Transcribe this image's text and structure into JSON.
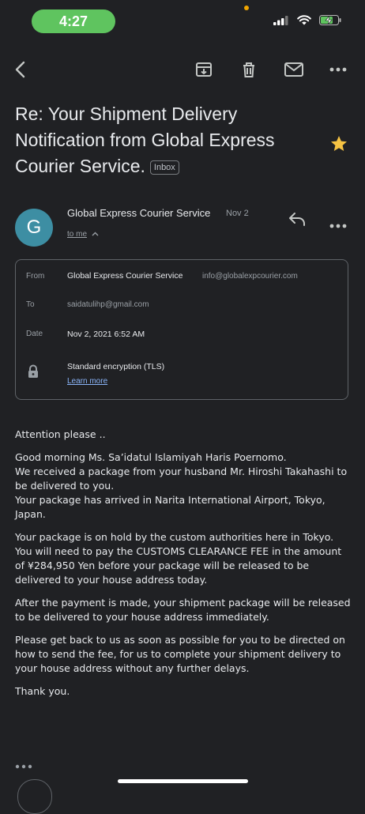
{
  "status_bar": {
    "time": "4:27"
  },
  "toolbar": {
    "icons": [
      "back-icon",
      "archive-icon",
      "trash-icon",
      "mail-icon",
      "more-icon"
    ]
  },
  "email": {
    "subject": "Re: Your Shipment Delivery Notification from Global Express Courier Service.",
    "label": "Inbox",
    "starred": true,
    "sender": {
      "initial": "G",
      "name": "Global Express Courier Service",
      "date": "Nov 2",
      "to": "to me",
      "avatar_color": "#3d8ea3"
    },
    "details": {
      "from_label": "From",
      "from_name": "Global Express Courier Service",
      "from_email": "info@globalexpcourier.com",
      "to_label": "To",
      "to_value": "saidatulihp@gmail.com",
      "date_label": "Date",
      "date_value": "Nov 2, 2021 6:52 AM",
      "encryption": "Standard encryption (TLS)",
      "learn_more": "Learn more"
    },
    "body": [
      "Attention please ..",
      "Good morning Ms. Sa’idatul Islamiyah Haris Poernomo.\nWe received a package from your husband Mr. Hiroshi Takahashi to be delivered to you.\nYour package has arrived in Narita International Airport, Tokyo, Japan.",
      "Your package is on hold by the custom authorities here in Tokyo.\nYou will need to pay the CUSTOMS CLEARANCE FEE in the amount of ¥284,950 Yen before your package will be released to be delivered to your house address today.",
      "After the payment is made, your shipment package will be released to be delivered to your house address immediately.",
      "Please get back to us as soon as possible for you to be directed on how to send the fee, for us to complete your shipment delivery to your house address without any further delays.",
      "Thank you."
    ]
  },
  "colors": {
    "background": "#202124",
    "time_pill": "#5fc45f",
    "star": "#f6c343",
    "link": "#8ab4f8"
  }
}
